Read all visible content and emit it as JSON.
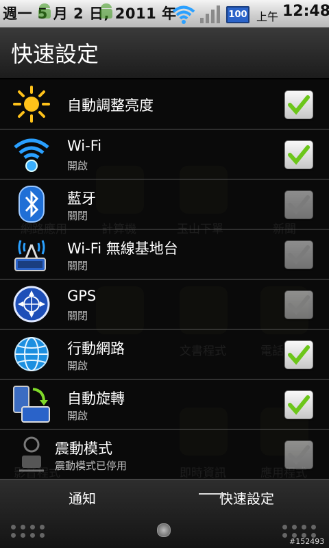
{
  "status_bar": {
    "date": "週一 5 月 2 日, 2011 年",
    "battery": "100",
    "ampm": "上午",
    "time": "12:48"
  },
  "panel": {
    "title": "快速設定",
    "background_labels": [
      "網路應用",
      "計算機",
      "玉山下單",
      "新聞",
      "文書程式",
      "電話",
      "即時資訊",
      "應用程式",
      "影音程式"
    ],
    "items": [
      {
        "icon": "brightness-icon",
        "title": "自動調整亮度",
        "subtitle": "",
        "checked": true
      },
      {
        "icon": "wifi-icon",
        "title": "Wi-Fi",
        "subtitle": "開啟",
        "checked": true
      },
      {
        "icon": "bluetooth-icon",
        "title": "藍牙",
        "subtitle": "關閉",
        "checked": false
      },
      {
        "icon": "hotspot-icon",
        "title": "Wi-Fi 無線基地台",
        "subtitle": "關閉",
        "checked": false
      },
      {
        "icon": "gps-icon",
        "title": "GPS",
        "subtitle": "關閉",
        "checked": false
      },
      {
        "icon": "globe-icon",
        "title": "行動網路",
        "subtitle": "開啟",
        "checked": true
      },
      {
        "icon": "rotate-icon",
        "title": "自動旋轉",
        "subtitle": "開啟",
        "checked": true
      },
      {
        "icon": "vibrate-icon",
        "title": "震動模式",
        "subtitle": "震動模式已停用",
        "checked": false
      }
    ]
  },
  "bottom_tabs": {
    "notifications": "通知",
    "quick_settings": "快速設定"
  },
  "watermark": "#152493",
  "colors": {
    "check_green": "#6cc61a",
    "battery_blue": "#2a63c9",
    "wifi_blue": "#2aa0ff"
  }
}
